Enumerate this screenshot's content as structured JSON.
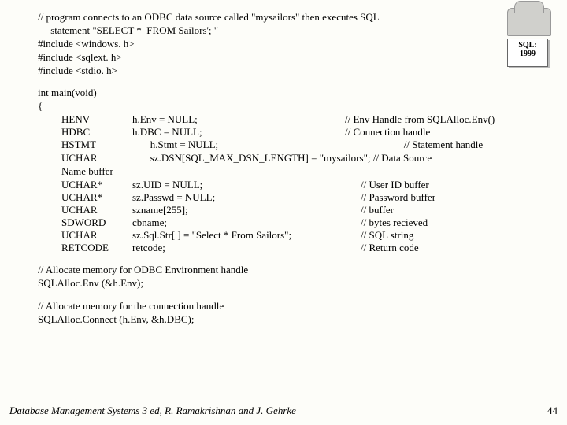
{
  "header": {
    "comment1": "// program connects to an ODBC data source called \"mysailors\" then executes SQL",
    "comment2": "     statement \"SELECT *  FROM Sailors'; \"",
    "inc1": "#include <windows. h>",
    "inc2": "#include <sqlext. h>",
    "inc3": "#include <stdio. h>"
  },
  "main_sig": "int main(void)",
  "brace": "{",
  "decls": [
    {
      "type": "HENV",
      "var": "h.Env = NULL;",
      "cmt": "// Env Handle from SQLAlloc.Env()"
    },
    {
      "type": "HDBC",
      "var": "h.DBC = NULL;",
      "cmt": "// Connection handle"
    },
    {
      "type": "HSTMT",
      "var": "       h.Stmt = NULL;",
      "cmt": "                       // Statement handle"
    },
    {
      "type": "UCHAR",
      "var": "       sz.DSN[SQL_MAX_DSN_LENGTH] = \"mysailors\"; // Data Source",
      "cmt": ""
    }
  ],
  "namebuf": "Name buffer",
  "decls2": [
    {
      "type": "UCHAR*",
      "var": "sz.UID = NULL;",
      "cmt": "// User ID buffer"
    },
    {
      "type": "UCHAR*",
      "var": "sz.Passwd = NULL;",
      "cmt": "// Password buffer"
    },
    {
      "type": "UCHAR",
      "var": "szname[255];",
      "cmt": "//  buffer"
    },
    {
      "type": "SDWORD",
      "var": "cbname;",
      "cmt": "// bytes recieved"
    },
    {
      "type": "UCHAR",
      "var": "sz.Sql.Str[ ] = \"Select * From Sailors\";",
      "cmt": "// SQL string"
    },
    {
      "type": "RETCODE",
      "var": "retcode;",
      "cmt": " // Return code"
    }
  ],
  "block1": {
    "c": "// Allocate memory for ODBC Environment handle",
    "s": "SQLAlloc.Env (&h.Env);"
  },
  "block2": {
    "c": "// Allocate memory for the connection handle",
    "s": "SQLAlloc.Connect (h.Env, &h.DBC);"
  },
  "footer": {
    "text": "Database Management Systems 3 ed,  R. Ramakrishnan and J. Gehrke",
    "page": "44"
  },
  "logo": {
    "l1": "SQL:",
    "l2": "1999"
  }
}
